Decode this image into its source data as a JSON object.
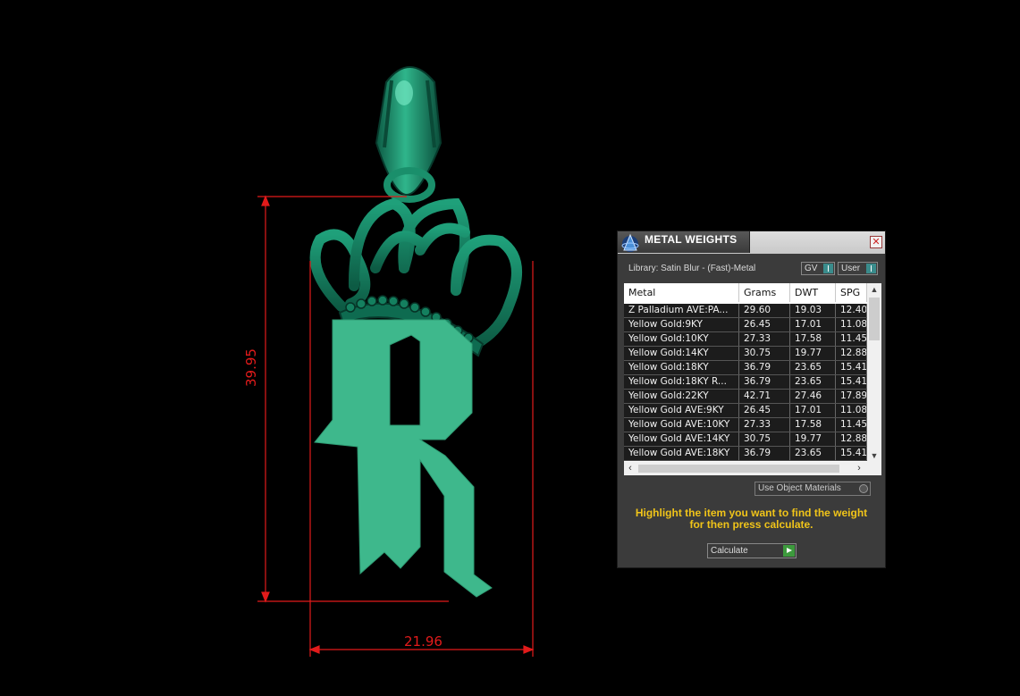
{
  "model": {
    "dimensions": {
      "height_label": "39.95",
      "width_label": "21.96"
    },
    "colors": {
      "background": "#000000",
      "model_fill": "#1e8f6e",
      "letter_fill": "#3eb88c",
      "dimension_lines": "#e21b1b"
    },
    "letter_glyph": "R"
  },
  "panel": {
    "title": "METAL WEIGHTS",
    "close_icon": "close-icon",
    "library_label": "Library: Satin Blur - (Fast)-Metal",
    "gv_label": "GV",
    "user_label": "User",
    "table": {
      "columns": [
        "Metal",
        "Grams",
        "DWT",
        "SPG"
      ],
      "rows": [
        [
          "Z Palladium AVE:PA...",
          "29.60",
          "19.03",
          "12.40"
        ],
        [
          "Yellow Gold:9KY",
          "26.45",
          "17.01",
          "11.08"
        ],
        [
          "Yellow Gold:10KY",
          "27.33",
          "17.58",
          "11.45"
        ],
        [
          "Yellow Gold:14KY",
          "30.75",
          "19.77",
          "12.88"
        ],
        [
          "Yellow Gold:18KY",
          "36.79",
          "23.65",
          "15.41"
        ],
        [
          "Yellow Gold:18KY R...",
          "36.79",
          "23.65",
          "15.41"
        ],
        [
          "Yellow Gold:22KY",
          "42.71",
          "27.46",
          "17.89"
        ],
        [
          "Yellow Gold AVE:9KY",
          "26.45",
          "17.01",
          "11.08"
        ],
        [
          "Yellow Gold AVE:10KY",
          "27.33",
          "17.58",
          "11.45"
        ],
        [
          "Yellow Gold AVE:14KY",
          "30.75",
          "19.77",
          "12.88"
        ],
        [
          "Yellow Gold AVE:18KY",
          "36.79",
          "23.65",
          "15.41"
        ]
      ]
    },
    "use_object_materials_label": "Use Object Materials",
    "hint_line1": "Highlight the item you want to find the weight",
    "hint_line2": "for then press calculate.",
    "calculate_label": "Calculate",
    "colors": {
      "panel_bg": "#3b3b3b",
      "hint_text": "#f0c419",
      "toggle_indicator": "#3a8c8c",
      "calculate_indicator": "#3d9a3d"
    }
  }
}
